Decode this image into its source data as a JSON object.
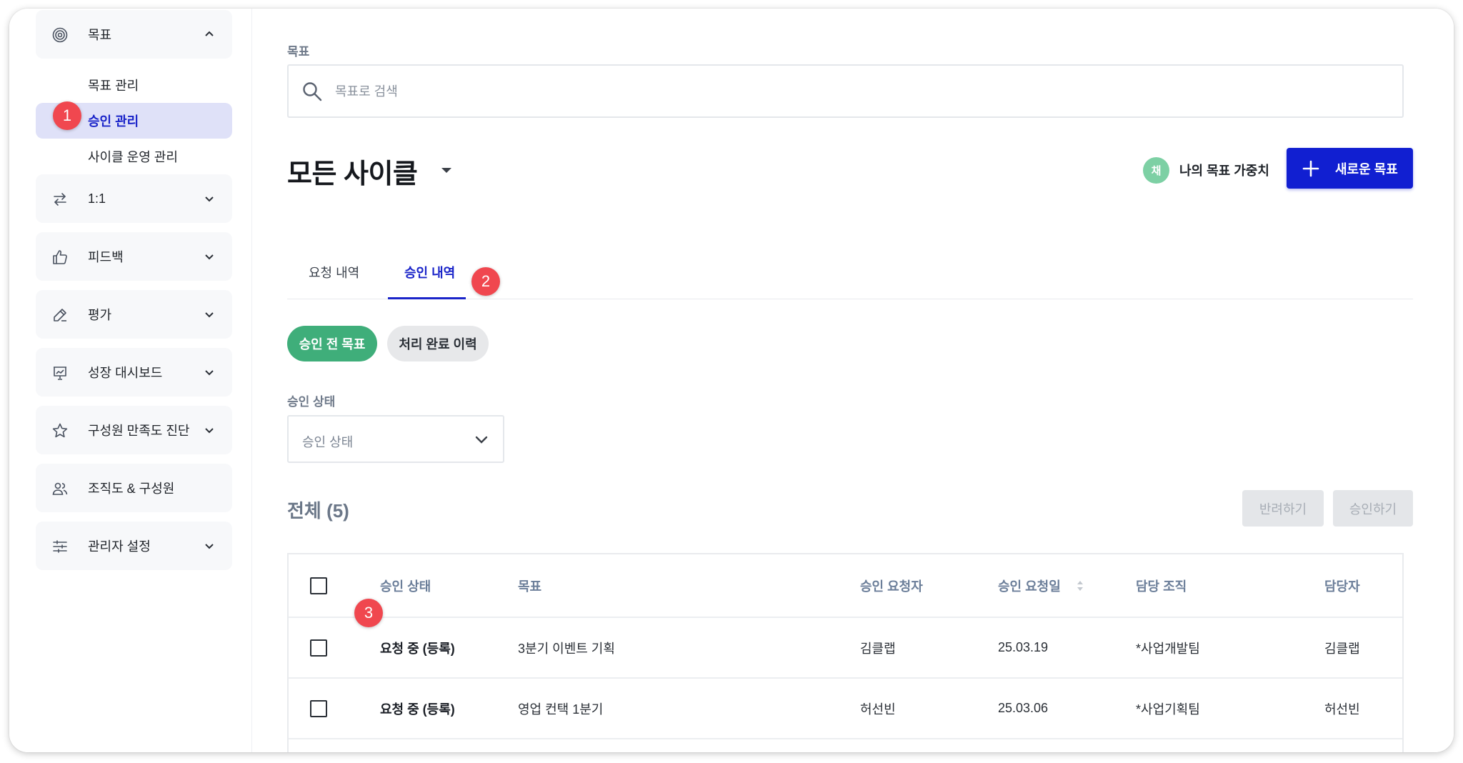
{
  "sidebar": {
    "goal_group": {
      "label": "목표",
      "items": [
        {
          "label": "목표 관리"
        },
        {
          "label": "승인 관리"
        },
        {
          "label": "사이클 운영 관리"
        }
      ]
    },
    "groups": [
      {
        "label": "1:1"
      },
      {
        "label": "피드백"
      },
      {
        "label": "평가"
      },
      {
        "label": "성장 대시보드"
      },
      {
        "label": "구성원 만족도 진단"
      },
      {
        "label": "조직도 & 구성원"
      },
      {
        "label": "관리자 설정"
      }
    ]
  },
  "badges": [
    "1",
    "2",
    "3"
  ],
  "main": {
    "section_label": "목표",
    "search_placeholder": "목표로 검색",
    "cycle_title": "모든 사이클",
    "weight": {
      "avatar": "채",
      "label": "나의 목표 가중치"
    },
    "new_goal_label": "새로운 목표",
    "tabs": [
      {
        "label": "요청 내역"
      },
      {
        "label": "승인 내역"
      }
    ],
    "chips": [
      {
        "label": "승인 전 목표"
      },
      {
        "label": "처리 완료 이력"
      }
    ],
    "status_filter": {
      "label": "승인 상태",
      "value": "승인 상태"
    },
    "total": "전체 (5)",
    "reject_label": "반려하기",
    "approve_label": "승인하기",
    "table": {
      "headers": [
        "승인 상태",
        "목표",
        "승인 요청자",
        "승인 요청일",
        "담당 조직",
        "담당자"
      ],
      "rows": [
        [
          "요청 중 (등록)",
          "3분기 이벤트 기획",
          "김클랩",
          "25.03.19",
          "*사업개발팀",
          "김클랩"
        ],
        [
          "요청 중 (등록)",
          "영업 컨택 1분기",
          "허선빈",
          "25.03.06",
          "*사업기획팀",
          "허선빈"
        ]
      ]
    }
  },
  "colors": {
    "primary": "#111fd1",
    "active_nav_bg": "#dfe1f8",
    "chip_active": "#3fae7a",
    "badge": "#f0474f"
  }
}
